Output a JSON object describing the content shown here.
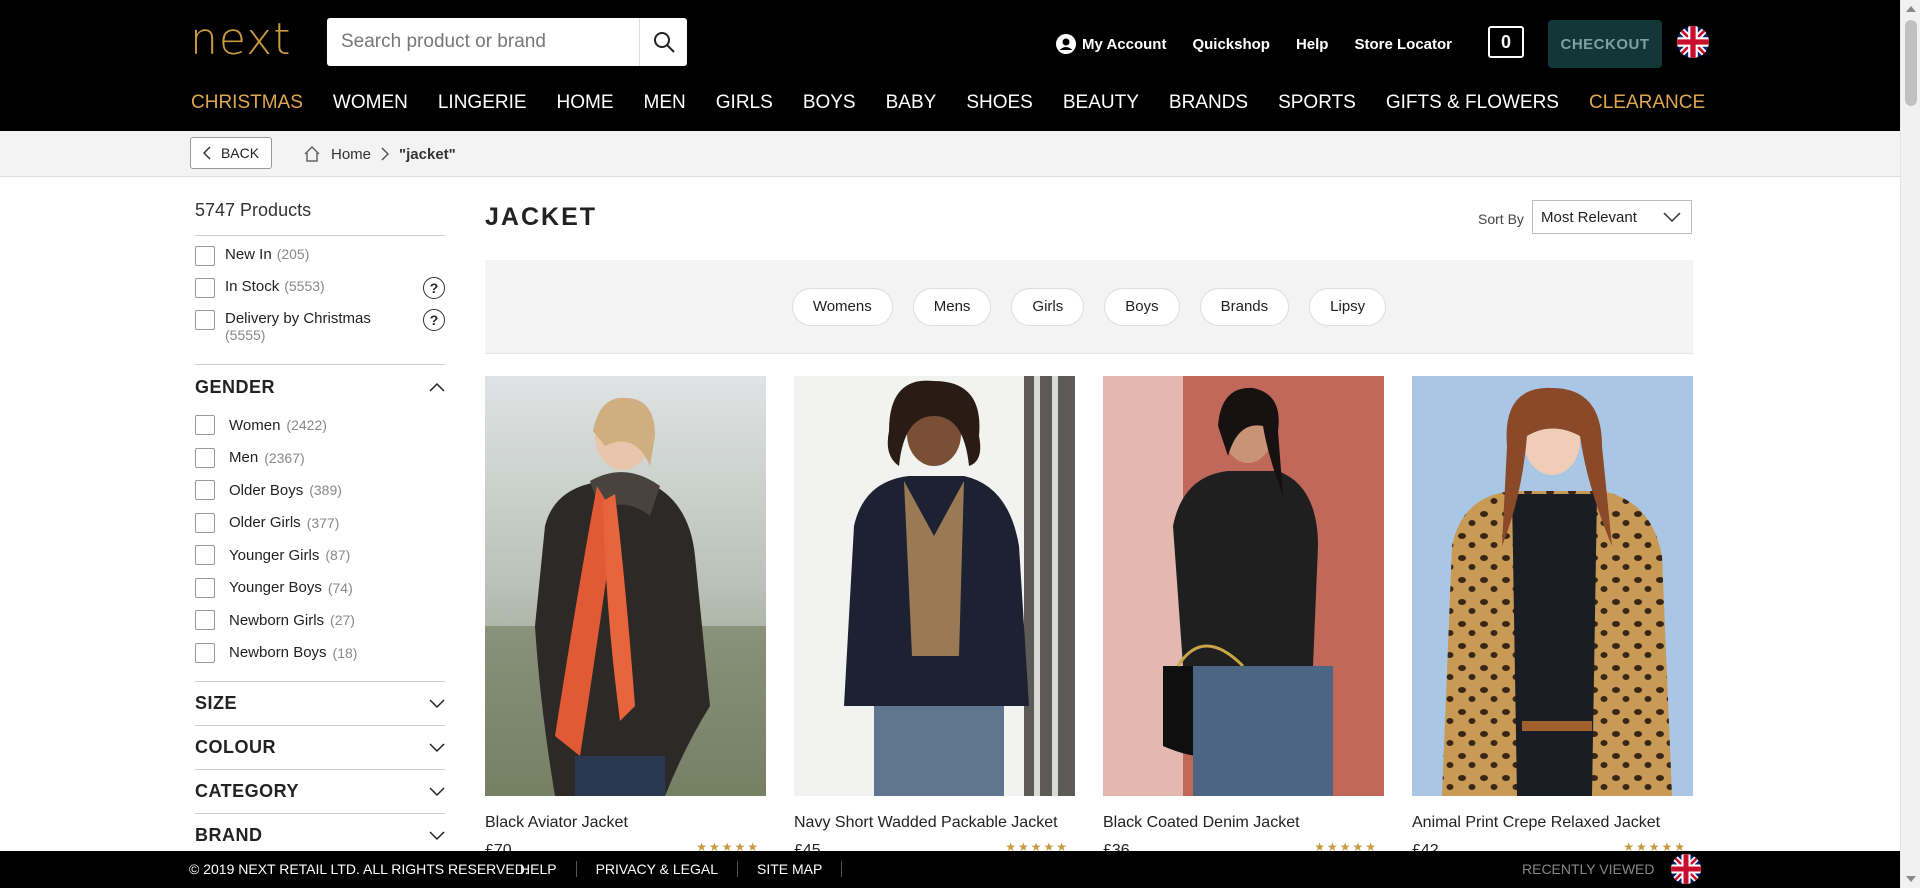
{
  "header": {
    "logo": "next",
    "search_placeholder": "Search product or brand",
    "links": {
      "account": "My Account",
      "quickshop": "Quickshop",
      "help": "Help",
      "store_locator": "Store Locator"
    },
    "bag_count": "0",
    "checkout": "CHECKOUT"
  },
  "nav": [
    "CHRISTMAS",
    "WOMEN",
    "LINGERIE",
    "HOME",
    "MEN",
    "GIRLS",
    "BOYS",
    "BABY",
    "SHOES",
    "BEAUTY",
    "BRANDS",
    "SPORTS",
    "GIFTS & FLOWERS",
    "CLEARANCE"
  ],
  "breadcrumb": {
    "back": "BACK",
    "home": "Home",
    "current": "\"jacket\""
  },
  "sidebar": {
    "product_count": "5747 Products",
    "quick_filters": [
      {
        "label": "New In",
        "count": "(205)"
      },
      {
        "label": "In Stock",
        "count": "(5553)"
      },
      {
        "label": "Delivery by Christmas",
        "count": "(5555)"
      }
    ],
    "gender_title": "GENDER",
    "gender": [
      {
        "label": "Women",
        "count": "(2422)"
      },
      {
        "label": "Men",
        "count": "(2367)"
      },
      {
        "label": "Older Boys",
        "count": "(389)"
      },
      {
        "label": "Older Girls",
        "count": "(377)"
      },
      {
        "label": "Younger Girls",
        "count": "(87)"
      },
      {
        "label": "Younger Boys",
        "count": "(74)"
      },
      {
        "label": "Newborn Girls",
        "count": "(27)"
      },
      {
        "label": "Newborn Boys",
        "count": "(18)"
      }
    ],
    "groups": [
      "SIZE",
      "COLOUR",
      "CATEGORY",
      "BRAND"
    ]
  },
  "main": {
    "title": "JACKET",
    "sort_label": "Sort By",
    "sort_value": "Most Relevant",
    "chips": [
      "Womens",
      "Mens",
      "Girls",
      "Boys",
      "Brands",
      "Lipsy"
    ],
    "products": [
      {
        "name": "Black Aviator Jacket",
        "price": "£70",
        "stars": "★★★★★"
      },
      {
        "name": "Navy Short Wadded Packable Jacket",
        "price": "£45",
        "stars": "★★★★★"
      },
      {
        "name": "Black Coated Denim Jacket",
        "price": "£36",
        "stars": "★★★★★"
      },
      {
        "name": "Animal Print Crepe Relaxed Jacket",
        "price": "£42",
        "stars": "★★★★★"
      }
    ]
  },
  "footer": {
    "copyright": "© 2019 NEXT RETAIL LTD. ALL RIGHTS RESERVED.",
    "links": [
      "HELP",
      "PRIVACY & LEGAL",
      "SITE MAP"
    ],
    "recently_viewed": "RECENTLY VIEWED"
  },
  "colors": {
    "brand_gold": "#c9993f",
    "header_bg": "#000000",
    "checkout_bg": "#133737",
    "accent_nav": "#e0a750"
  }
}
